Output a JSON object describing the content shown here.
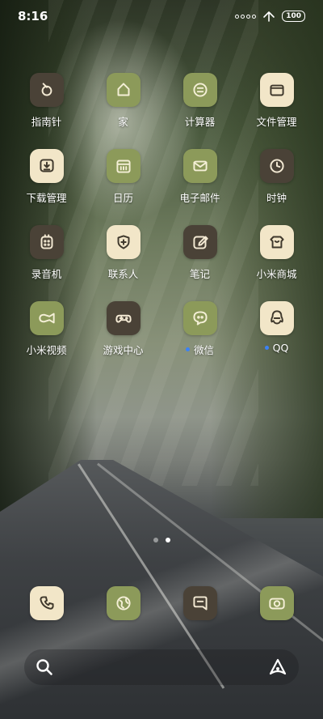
{
  "status_bar": {
    "time": "8:16",
    "battery": "100"
  },
  "apps": [
    {
      "label": "指南针",
      "icon": "compass-icon",
      "theme": "dark",
      "dot": false
    },
    {
      "label": "家",
      "icon": "home-icon",
      "theme": "olive",
      "dot": false
    },
    {
      "label": "计算器",
      "icon": "calculator-icon",
      "theme": "olive",
      "dot": false
    },
    {
      "label": "文件管理",
      "icon": "file-manager-icon",
      "theme": "cream",
      "dot": false
    },
    {
      "label": "下载管理",
      "icon": "download-icon",
      "theme": "cream",
      "dot": false
    },
    {
      "label": "日历",
      "icon": "calendar-icon",
      "theme": "olive",
      "dot": false
    },
    {
      "label": "电子邮件",
      "icon": "mail-icon",
      "theme": "olive",
      "dot": false
    },
    {
      "label": "时钟",
      "icon": "clock-icon",
      "theme": "dark",
      "dot": false
    },
    {
      "label": "录音机",
      "icon": "recorder-icon",
      "theme": "dark",
      "dot": false
    },
    {
      "label": "联系人",
      "icon": "contacts-icon",
      "theme": "cream",
      "dot": false
    },
    {
      "label": "笔记",
      "icon": "notes-icon",
      "theme": "dark",
      "dot": false
    },
    {
      "label": "小米商城",
      "icon": "mi-store-icon",
      "theme": "cream",
      "dot": false
    },
    {
      "label": "小米视频",
      "icon": "video-icon",
      "theme": "olive",
      "dot": false
    },
    {
      "label": "游戏中心",
      "icon": "gamepad-icon",
      "theme": "dark",
      "dot": false
    },
    {
      "label": "微信",
      "icon": "wechat-icon",
      "theme": "olive",
      "dot": true
    },
    {
      "label": "QQ",
      "icon": "qq-icon",
      "theme": "cream",
      "dot": true
    }
  ],
  "dock": [
    {
      "icon": "phone-icon",
      "theme": "cream"
    },
    {
      "icon": "browser-icon",
      "theme": "olive"
    },
    {
      "icon": "messages-icon",
      "theme": "dark"
    },
    {
      "icon": "camera-icon",
      "theme": "olive"
    }
  ],
  "pages": {
    "count": 2,
    "active": 1
  },
  "colors": {
    "icon_dark": "#4a4237",
    "icon_olive": "#8c9a5a",
    "icon_cream": "#f2e6c8",
    "notification_dot": "#3b82f6"
  }
}
